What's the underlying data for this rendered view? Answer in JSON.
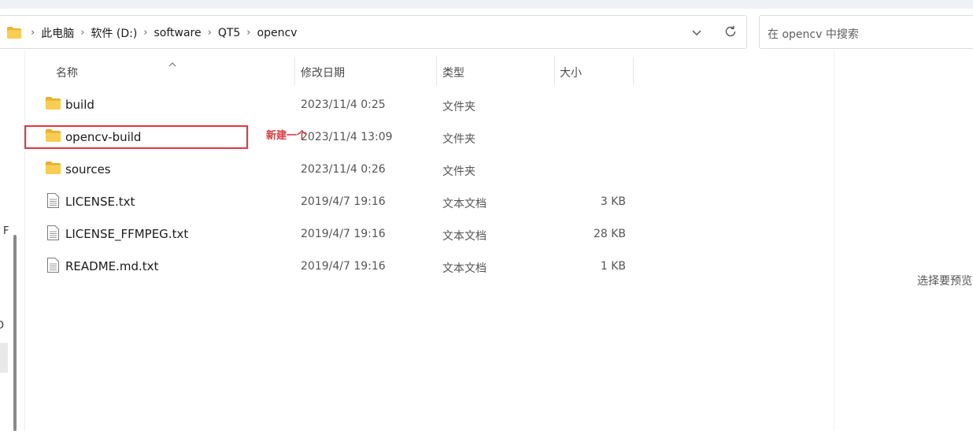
{
  "breadcrumbs": [
    "此电脑",
    "软件 (D:)",
    "software",
    "QT5",
    "opencv"
  ],
  "search": {
    "placeholder": "在 opencv 中搜索"
  },
  "columns": {
    "name": "名称",
    "date": "修改日期",
    "type": "类型",
    "size": "大小"
  },
  "files": [
    {
      "name": "build",
      "date": "2023/11/4 0:25",
      "type": "文件夹",
      "size": "",
      "icon": "folder-icon"
    },
    {
      "name": "opencv-build",
      "date": "2023/11/4 13:09",
      "type": "文件夹",
      "size": "",
      "icon": "folder-icon"
    },
    {
      "name": "sources",
      "date": "2023/11/4 0:26",
      "type": "文件夹",
      "size": "",
      "icon": "folder-icon"
    },
    {
      "name": "LICENSE.txt",
      "date": "2019/4/7 19:16",
      "type": "文本文档",
      "size": "3 KB",
      "icon": "text-file-icon"
    },
    {
      "name": "LICENSE_FFMPEG.txt",
      "date": "2019/4/7 19:16",
      "type": "文本文档",
      "size": "28 KB",
      "icon": "text-file-icon"
    },
    {
      "name": "README.md.txt",
      "date": "2019/4/7 19:16",
      "type": "文本文档",
      "size": "1 KB",
      "icon": "text-file-icon"
    }
  ],
  "annotation": "新建一个",
  "preview": {
    "text": "选择要预览"
  },
  "left_fragments": [
    "F",
    "D"
  ],
  "colors": {
    "accent_folder": "#f6c542",
    "annotation_red": "#e0383e"
  }
}
